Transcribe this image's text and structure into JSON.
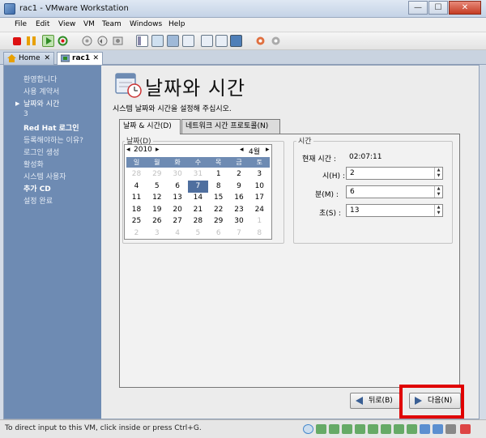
{
  "window": {
    "title": "rac1 - VMware Workstation",
    "minimize": "—",
    "maximize": "☐",
    "close": "✕"
  },
  "menu": [
    "File",
    "Edit",
    "View",
    "VM",
    "Team",
    "Windows",
    "Help"
  ],
  "tabs": [
    {
      "label": "Home",
      "close": "✕"
    },
    {
      "label": "rac1",
      "close": "✕"
    }
  ],
  "sidebar": {
    "steps": [
      {
        "label": "환영합니다"
      },
      {
        "label": "사용 계약서"
      },
      {
        "label": "날짜와 시간",
        "current": true
      },
      {
        "label": "3"
      },
      {
        "label": "Red Hat 로그인"
      },
      {
        "label": "등록해야하는 이유?"
      },
      {
        "label": "로그인 생성"
      },
      {
        "label": "활성화"
      },
      {
        "label": "시스템 사용자"
      },
      {
        "label": "추가 CD"
      },
      {
        "label": "설정 완료"
      }
    ],
    "current_marker": "▶"
  },
  "header": {
    "title": "날짜와 시간",
    "subtitle": "시스템 날짜와 시간을 설정해 주십시오."
  },
  "inner_tabs": [
    {
      "label": "날짜 & 시간(D)"
    },
    {
      "label": "네트워크 시간 프로토콜(N)"
    }
  ],
  "date": {
    "group_label": "날짜(D)",
    "year": "2010",
    "month": "4월",
    "prev": "◂",
    "next": "▸",
    "weekdays": [
      "일",
      "월",
      "화",
      "수",
      "목",
      "금",
      "토"
    ],
    "weeks": [
      [
        "28",
        "29",
        "30",
        "31",
        "1",
        "2",
        "3"
      ],
      [
        "4",
        "5",
        "6",
        "7",
        "8",
        "9",
        "10"
      ],
      [
        "11",
        "12",
        "13",
        "14",
        "15",
        "16",
        "17"
      ],
      [
        "18",
        "19",
        "20",
        "21",
        "22",
        "23",
        "24"
      ],
      [
        "25",
        "26",
        "27",
        "28",
        "29",
        "30",
        "1"
      ],
      [
        "2",
        "3",
        "4",
        "5",
        "6",
        "7",
        "8"
      ]
    ],
    "selected_day": "7"
  },
  "time": {
    "group_label": "시간",
    "current_label": "현재 시간 :",
    "current_value": "02:07:11",
    "hour_label": "시(H) :",
    "hour_value": "2",
    "minute_label": "분(M) :",
    "minute_value": "6",
    "second_label": "초(S) :",
    "second_value": "13"
  },
  "buttons": {
    "back": "뒤로(B)",
    "next": "다음(N)"
  },
  "status": {
    "text": "To direct input to this VM, click inside or press Ctrl+G."
  },
  "colors": {
    "sidebar": "#6e8bb3",
    "selected": "#4f6f9f",
    "highlight": "#e00000"
  }
}
